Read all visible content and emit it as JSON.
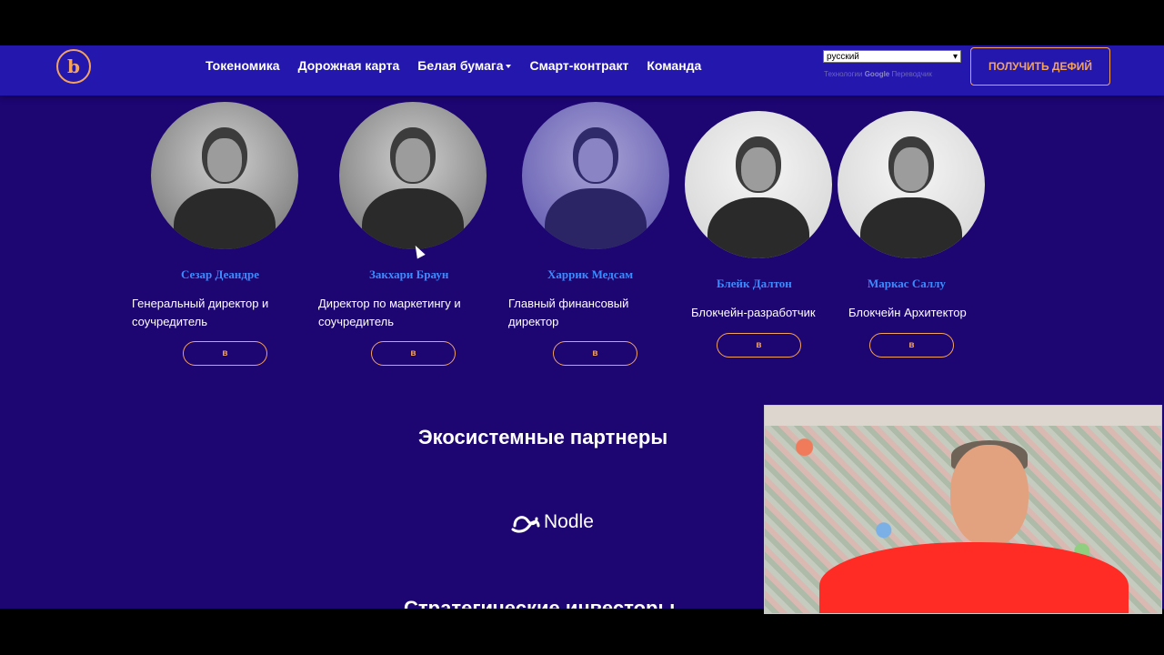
{
  "header": {
    "logo_text": "b",
    "nav": [
      {
        "label": "Токеномика"
      },
      {
        "label": "Дорожная карта"
      },
      {
        "label": "Белая бумага"
      },
      {
        "label": "Смарт-контракт"
      },
      {
        "label": "Команда"
      }
    ],
    "language_select": {
      "value": "русский"
    },
    "translate_note": {
      "prefix": "Технологии",
      "brand": "Google",
      "suffix": "Переводчик"
    },
    "cta_label": "ПОЛУЧИТЬ ДЕФИЙ"
  },
  "team": [
    {
      "name": "Сезар Деандре",
      "role": "Генеральный директор и соучредитель",
      "button": "в"
    },
    {
      "name": "Закхари Браун",
      "role": "Директор по маркетингу и соучредитель",
      "button": "в"
    },
    {
      "name": "Харрик Медсам",
      "role": "Главный финансовый директор",
      "button": "в"
    },
    {
      "name": "Блейк Далтон",
      "role": "Блокчейн-разработчик",
      "button": "в"
    },
    {
      "name": "Маркас Саллу",
      "role": "Блокчейн Архитектор",
      "button": "в"
    }
  ],
  "partners": {
    "title": "Экосистемные партнеры",
    "items": [
      {
        "name": "Nodle"
      }
    ]
  },
  "next_section_title": "Стратегические инвесторы",
  "colors": {
    "background": "#1d0572",
    "navbar": "#2417ad",
    "accent": "#f3a35f",
    "name": "#3b8cff"
  },
  "icons": [
    "logo-icon",
    "dropdown-caret-icon",
    "nodle-logo-icon",
    "mouse-cursor-icon"
  ]
}
